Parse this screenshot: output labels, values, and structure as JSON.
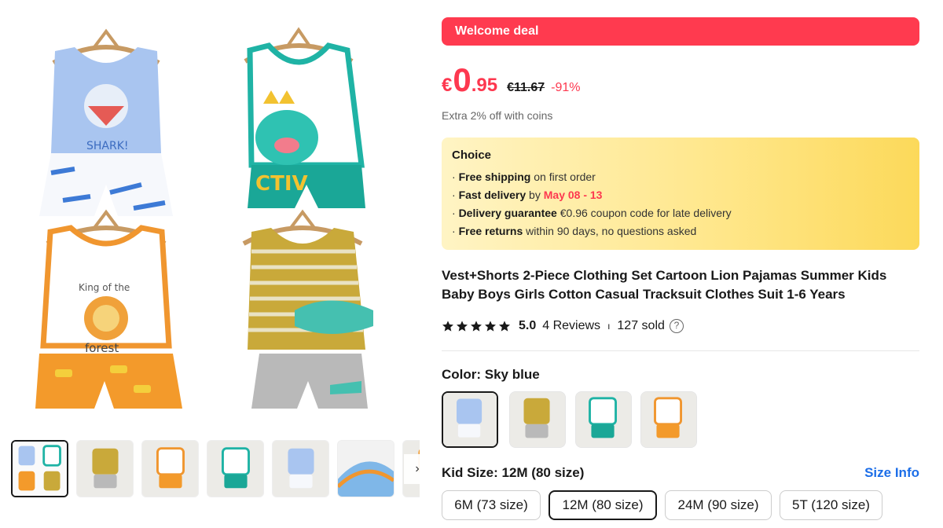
{
  "gallery": {
    "main_alt": "Kids clothing sets on hangers",
    "thumb_count": 7,
    "next_icon": "›"
  },
  "deal": {
    "banner": "Welcome deal"
  },
  "price": {
    "currency": "€",
    "whole": "0",
    "fraction": ".95",
    "original": "€11.67",
    "discount": "-91%",
    "coins_note": "Extra 2% off with coins"
  },
  "choice": {
    "title": "Choice",
    "lines": [
      {
        "bullet": "· ",
        "bold": "Free shipping",
        "text": " on first order",
        "red": ""
      },
      {
        "bullet": "· ",
        "bold": "Fast delivery",
        "text": " by ",
        "red": "May 08 - 13"
      },
      {
        "bullet": "· ",
        "bold": "Delivery guarantee",
        "text": "  €0.96 coupon code for late delivery",
        "red": ""
      },
      {
        "bullet": "· ",
        "bold": "Free returns",
        "text": "  within 90 days, no questions asked",
        "red": ""
      }
    ]
  },
  "product": {
    "title": "Vest+Shorts 2-Piece Clothing Set Cartoon Lion Pajamas Summer Kids Baby Boys Girls Cotton Casual Tracksuit Clothes Suit 1-6 Years",
    "rating": "5.0",
    "reviews": "4 Reviews",
    "separator": "ı",
    "sold": "127 sold",
    "help": "?"
  },
  "color": {
    "label": "Color: Sky blue",
    "options": [
      "Sky blue",
      "Yellow",
      "Green",
      "Orange"
    ]
  },
  "size": {
    "label": "Kid Size: 12M (80 size)",
    "info_link": "Size Info",
    "options": [
      "6M (73 size)",
      "12M (80 size)",
      "24M (90 size)",
      "5T (120 size)"
    ],
    "selected": "12M (80 size)"
  },
  "colors": {
    "brand_red": "#fd384f",
    "link_blue": "#1c6ee8"
  }
}
